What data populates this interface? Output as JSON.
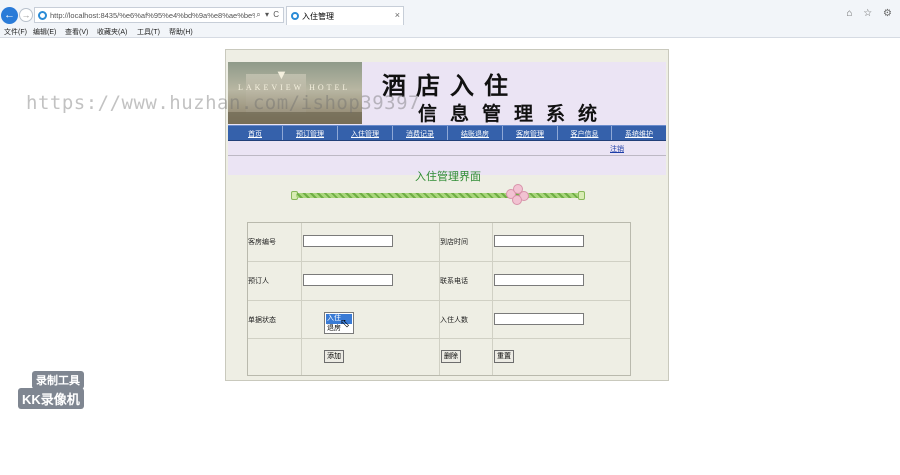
{
  "browser": {
    "url": "http://localhost:8435/%e6%af%95%e4%bd%9a%e8%ae%be%",
    "address_icons": "⌕ ▾ C",
    "tab_title": "入住管理",
    "tab_close": "×",
    "toolbar_icons": "⌂ ☆ ⚙",
    "menu": [
      "文件(F)",
      "编辑(E)",
      "查看(V)",
      "收藏夹(A)",
      "工具(T)",
      "帮助(H)"
    ]
  },
  "banner": {
    "logo_text": "LAKEVIEW HOTEL",
    "title_main": "酒店入住",
    "title_sub": "信息管理系统"
  },
  "nav": {
    "items": [
      "首页",
      "预订管理",
      "入住管理",
      "消费记录",
      "结账退房",
      "客房管理",
      "客户信息",
      "系统维护"
    ],
    "logout": "注销"
  },
  "panel": {
    "title": "入住管理界面"
  },
  "form": {
    "room_no_label": "客房编号",
    "arrive_time_label": "到店时间",
    "booker_label": "预订人",
    "phone_label": "联系电话",
    "option_label": "单据状态",
    "options": [
      "入住",
      "退房"
    ],
    "selected_option": "入住",
    "guest_count_label": "入住人数",
    "add_button": "添加",
    "delete_button": "删除",
    "reset_button": "重置"
  },
  "overlay": {
    "watermark": "https://www.huzhan.com/ishop39397",
    "recorder_line1": "录制工具",
    "recorder_line2": "KK录像机"
  },
  "colors": {
    "nav_bg": "#3561ab",
    "title_green": "#2f8c34",
    "page_bg": "#eeeee4",
    "banner_bg": "#ebe4f4"
  }
}
